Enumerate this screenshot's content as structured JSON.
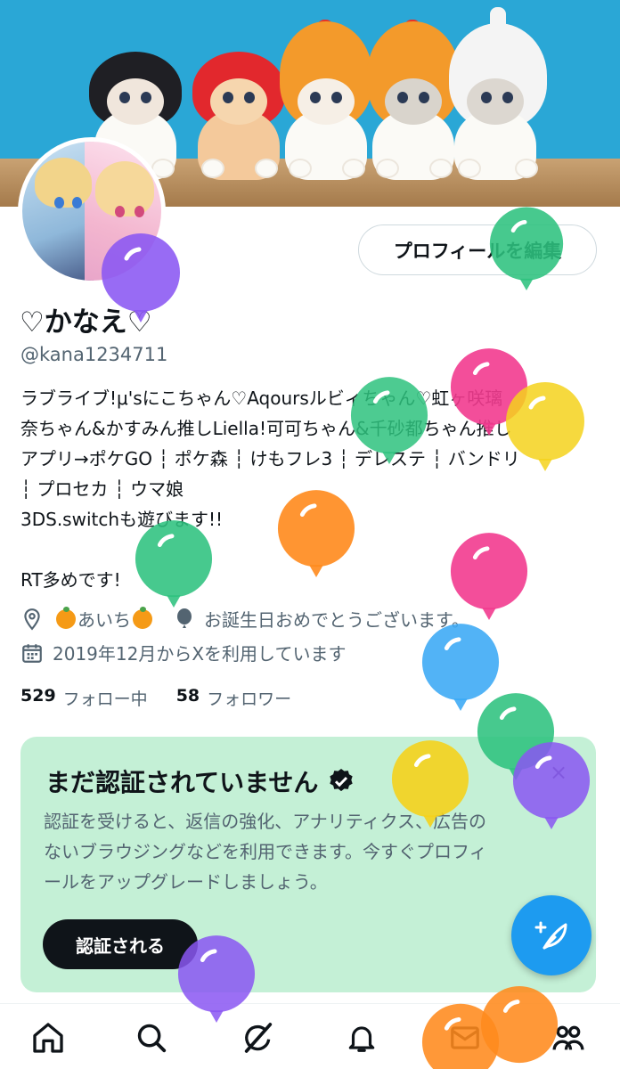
{
  "profile": {
    "edit_button": "プロフィールを編集",
    "display_name": "♡かなえ♡",
    "handle": "@kana1234711",
    "bio_lines": [
      "ラブライブ!μ'sにこちゃん♡Aqoursルビィちゃん♡虹ヶ咲璃",
      "奈ちゃん&かすみん推しLiella!可可ちゃん&千砂都ちゃん推し",
      "アプリ→ポケGO ┆ ポケ森 ┆ けもフレ3 ┆ デレステ ┆ バンドリ",
      "┆ プロセカ ┆ ウマ娘",
      "3DS.switchも遊びます!!",
      "",
      "RT多めです!"
    ],
    "location": "あいち",
    "birthday": "お誕生日おめでとうございます。",
    "joined": "2019年12月からXを利用しています",
    "following_count": "529",
    "following_label": "フォロー中",
    "followers_count": "58",
    "followers_label": "フォロワー"
  },
  "verification_card": {
    "title": "まだ認証されていません",
    "description_lines": [
      "認証を受けると、返信の強化、アナリティクス、広告の",
      "ないブラウジングなどを利用できます。今すぐプロフィ",
      "ールをアップグレードしましょう。"
    ],
    "button": "認証される",
    "close_icon": "×",
    "background": "#c4f0d6"
  },
  "icons": {
    "location": "map-pin-icon",
    "birthday": "balloon-icon",
    "joined": "calendar-icon",
    "compose": "compose-post-icon",
    "nav": [
      "home-icon",
      "search-icon",
      "grok-icon",
      "notifications-icon",
      "messages-icon",
      "communities-icon"
    ]
  },
  "colors": {
    "accent": "#1d9bf0",
    "text_primary": "#0f1419",
    "text_secondary": "#536471",
    "banner_sky": "#2aa7d6",
    "balloon_palette": [
      "#8a56f2",
      "#2ec27e",
      "#f23b8f",
      "#f5d21c",
      "#ff8a1c",
      "#3aa9f5"
    ]
  }
}
